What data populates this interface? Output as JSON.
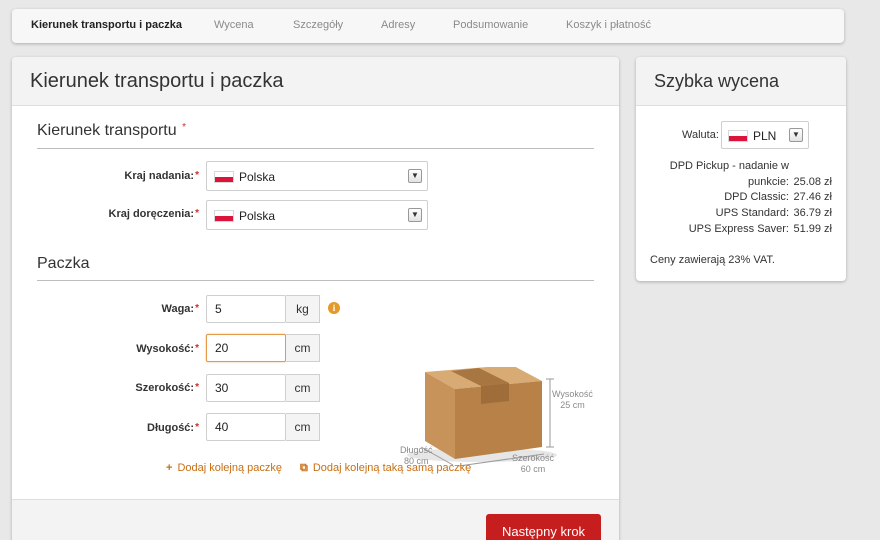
{
  "steps": [
    {
      "label": "Kierunek transportu i paczka",
      "active": true
    },
    {
      "label": "Wycena",
      "active": false
    },
    {
      "label": "Szczegóły",
      "active": false
    },
    {
      "label": "Adresy",
      "active": false
    },
    {
      "label": "Podsumowanie",
      "active": false
    },
    {
      "label": "Koszyk i płatność",
      "active": false
    }
  ],
  "main": {
    "title": "Kierunek transportu i paczka",
    "direction": {
      "title": "Kierunek transportu",
      "required_mark": "*",
      "origin": {
        "label": "Kraj nadania:",
        "value": "Polska",
        "flag": "flag-poland"
      },
      "destination": {
        "label": "Kraj doręczenia:",
        "value": "Polska",
        "flag": "flag-poland"
      }
    },
    "package": {
      "title": "Paczka",
      "fields": {
        "weight": {
          "label": "Waga:",
          "value": "5",
          "unit": "kg"
        },
        "height": {
          "label": "Wysokość:",
          "value": "20",
          "unit": "cm"
        },
        "width": {
          "label": "Szerokość:",
          "value": "30",
          "unit": "cm"
        },
        "length": {
          "label": "Długość:",
          "value": "40",
          "unit": "cm"
        }
      },
      "illustration": {
        "height_label": "Wysokość",
        "height_value": "25 cm",
        "width_label": "Szerokość",
        "width_value": "60 cm",
        "length_label": "Długość",
        "length_value": "80 cm"
      },
      "add_package": "Dodaj kolejną paczkę",
      "add_same_package": "Dodaj kolejną taką samą paczkę"
    },
    "next_button": "Następny krok"
  },
  "quote": {
    "title": "Szybka wycena",
    "currency_label": "Waluta:",
    "currency_value": "PLN",
    "prices": {
      "dpd_pickup_line1": "DPD Pickup - nadanie w",
      "dpd_pickup_line2": "punkcie:",
      "dpd_pickup_price": "25.08 zł",
      "dpd_classic": "DPD Classic:",
      "dpd_classic_price": "27.46 zł",
      "ups_standard": "UPS Standard:",
      "ups_standard_price": "36.79 zł",
      "ups_express": "UPS Express Saver:",
      "ups_express_price": "51.99 zł"
    },
    "vat_note": "Ceny zawierają 23% VAT."
  },
  "colors": {
    "accent_red": "#c61e1e",
    "link_orange": "#c76f14",
    "required_red": "#c9302c"
  }
}
